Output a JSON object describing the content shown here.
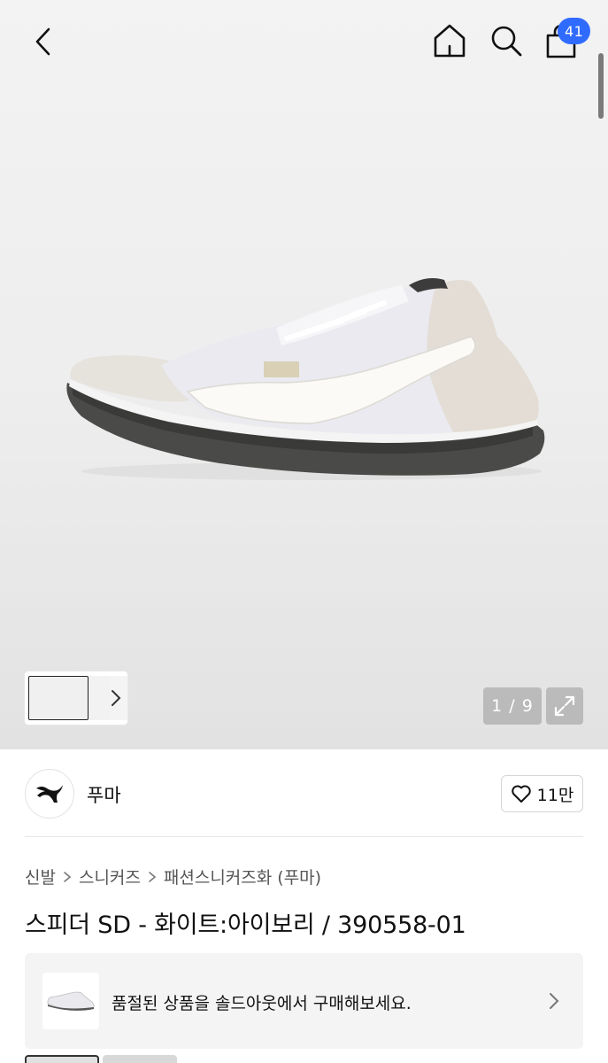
{
  "header": {
    "back_icon": "chevron-left-icon",
    "home_icon": "home-icon",
    "search_icon": "search-icon",
    "cart_icon": "shopping-bag-icon",
    "cart_count": "41",
    "badge_color": "#2f6bff"
  },
  "gallery": {
    "counter": "1 / 9",
    "expand_icon": "expand-icon",
    "thumbnails_arrow_icon": "chevron-right-icon"
  },
  "brand": {
    "name": "푸마",
    "logo_icon": "puma-logo-icon",
    "like_icon": "heart-icon",
    "like_count": "11만"
  },
  "breadcrumb": {
    "items": [
      "신발",
      "스니커즈",
      "패션스니커즈화 (푸마)"
    ]
  },
  "product": {
    "title": "스피더 SD - 화이트:아이보리 / 390558-01"
  },
  "soldout_banner": {
    "text": "품절된 상품을 솔드아웃에서 구매해보세요."
  }
}
